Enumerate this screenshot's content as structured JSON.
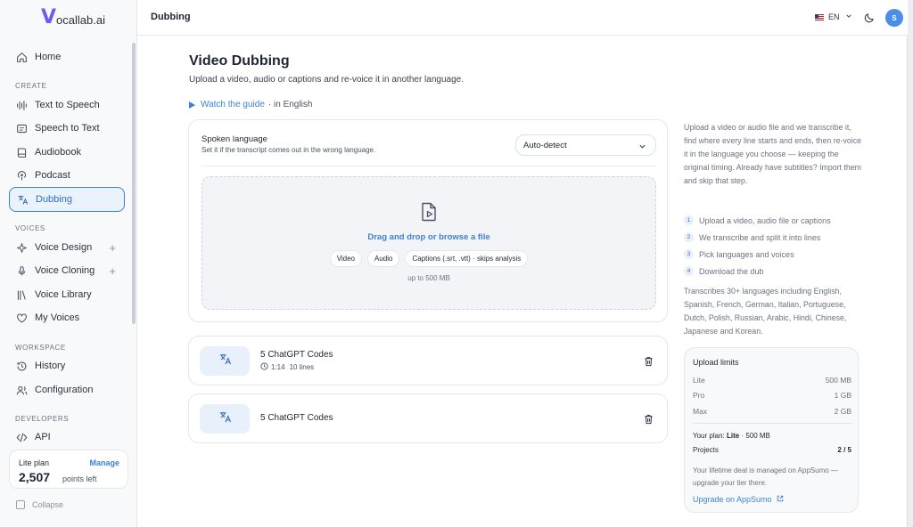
{
  "app": {
    "logo_v": "V",
    "logo_rest": "ocallab.ai"
  },
  "sidebar": {
    "home": "Home",
    "section_create": "CREATE",
    "create_items": [
      "Text to Speech",
      "Speech to Text",
      "Audiobook",
      "Podcast",
      "Dubbing"
    ],
    "section_voices": "VOICES",
    "voice_items": [
      "Voice Design",
      "Voice Cloning",
      "Voice Library",
      "My Voices"
    ],
    "section_workspace": "WORKSPACE",
    "workspace_items": [
      "History",
      "Configuration"
    ],
    "section_developers": "DEVELOPERS",
    "developer_items": [
      "API"
    ],
    "plan": {
      "name": "Lite plan",
      "manage": "Manage",
      "points": "2,507",
      "points_label": "points left"
    },
    "collapse": "Collapse"
  },
  "topbar": {
    "title": "Dubbing",
    "language": "EN",
    "avatar": "S"
  },
  "main": {
    "title": "Video Dubbing",
    "subtitle": "Upload a video, audio or captions and re-voice it in another language.",
    "guide_link": "Watch the guide",
    "guide_suffix": "· in English",
    "spoken_label": "Spoken language",
    "spoken_hint": "Set it if the transcript comes out in the wrong language.",
    "spoken_value": "Auto-detect",
    "drop_text": "Drag and drop or browse a file",
    "chips": [
      "Video",
      "Audio",
      "Captions (.srt, .vtt) · skips analysis"
    ],
    "limit": "up to 500 MB"
  },
  "projects": [
    {
      "name": "5 ChatGPT Codes",
      "duration": "1:14",
      "lines": "10 lines"
    },
    {
      "name": "5 ChatGPT Codes"
    }
  ],
  "info": {
    "description": "Upload a video or audio file and we transcribe it, find where every line starts and ends, then re-voice it in the language you choose — keeping the original timing. Already have subtitles? Import them and skip that step.",
    "steps": [
      "Upload a video, audio file or captions",
      "We transcribe and split it into lines",
      "Pick languages and voices",
      "Download the dub"
    ],
    "languages": "Transcribes 30+ languages including English, Spanish, French, German, Italian, Portuguese, Dutch, Polish, Russian, Arabic, Hindi, Chinese, Japanese and Korean."
  },
  "limits": {
    "title": "Upload limits",
    "rows": [
      {
        "plan": "Lite",
        "size": "500 MB"
      },
      {
        "plan": "Pro",
        "size": "1 GB"
      },
      {
        "plan": "Max",
        "size": "2 GB"
      }
    ],
    "your_plan_label": "Your plan:",
    "your_plan_value": "Lite",
    "your_plan_size": "· 500 MB",
    "projects_label": "Projects",
    "projects_value": "2 / 5",
    "note": "Your lifetime deal is managed on AppSumo — upgrade your tier there.",
    "upgrade": "Upgrade on AppSumo"
  },
  "colors": {
    "accent": "#3b82d6",
    "logo": "#6d5cf0",
    "avatar": "#4b8ee8"
  }
}
